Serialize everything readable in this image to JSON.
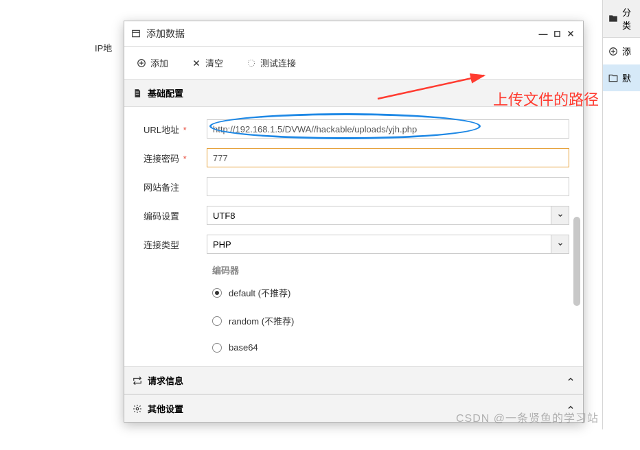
{
  "background": {
    "left_col_header": "IP地"
  },
  "right_panel": {
    "header_icon": "folder-solid-icon",
    "header_label": "分类",
    "add_label": "添",
    "item_label": "默"
  },
  "dialog": {
    "title": "添加数据",
    "toolbar": {
      "add": "添加",
      "clear": "清空",
      "test": "测试连接"
    },
    "section_basic": "基础配置",
    "section_request": "请求信息",
    "section_other": "其他设置",
    "form": {
      "url_label": "URL地址",
      "url_value": "http://192.168.1.5/DVWA//hackable/uploads/yjh.php",
      "pwd_label": "连接密码",
      "pwd_value": "777",
      "note_label": "网站备注",
      "note_value": "",
      "encode_label": "编码设置",
      "encode_value": "UTF8",
      "conn_label": "连接类型",
      "conn_value": "PHP",
      "encoder_title": "编码器",
      "encoders": [
        {
          "label": "default (不推荐)",
          "checked": true
        },
        {
          "label": "random (不推荐)",
          "checked": false
        },
        {
          "label": "base64",
          "checked": false
        }
      ]
    }
  },
  "annotation": {
    "text": "上传文件的路径"
  },
  "watermark": "CSDN @一条贤鱼的学习站"
}
